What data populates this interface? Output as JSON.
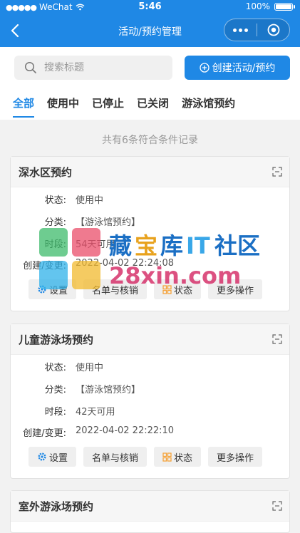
{
  "status_bar": {
    "carrier": "WeChat",
    "time": "5:46",
    "battery": "100%"
  },
  "nav": {
    "title": "活动/预约管理"
  },
  "search": {
    "placeholder": "搜索标题"
  },
  "create_button": {
    "label": "创建活动/预约"
  },
  "tabs": [
    {
      "label": "全部",
      "active": true
    },
    {
      "label": "使用中",
      "active": false
    },
    {
      "label": "已停止",
      "active": false
    },
    {
      "label": "已关闭",
      "active": false
    },
    {
      "label": "游泳馆预约",
      "active": false
    }
  ],
  "count_text": "共有6条符合条件记录",
  "field_labels": {
    "status": "状态:",
    "category": "分类:",
    "period": "时段:",
    "created": "创建/变更:"
  },
  "action_labels": {
    "settings": "设置",
    "list": "名单与核销",
    "status": "状态",
    "more": "更多操作"
  },
  "cards": [
    {
      "title": "深水区预约",
      "status": "使用中",
      "category": "【游泳馆预约】",
      "period": "54天可用",
      "created": "2022-04-02 22:24:08"
    },
    {
      "title": "儿童游泳场预约",
      "status": "使用中",
      "category": "【游泳馆预约】",
      "period": "42天可用",
      "created": "2022-04-02 22:22:10"
    },
    {
      "title": "室外游泳场预约"
    }
  ],
  "watermark": {
    "line1": "藏宝库IT社区",
    "line2": "28xin.com"
  },
  "colors": {
    "primary": "#1f88e5",
    "settings_icon": "#1f88e5",
    "status_icon": "#f5a33b"
  }
}
